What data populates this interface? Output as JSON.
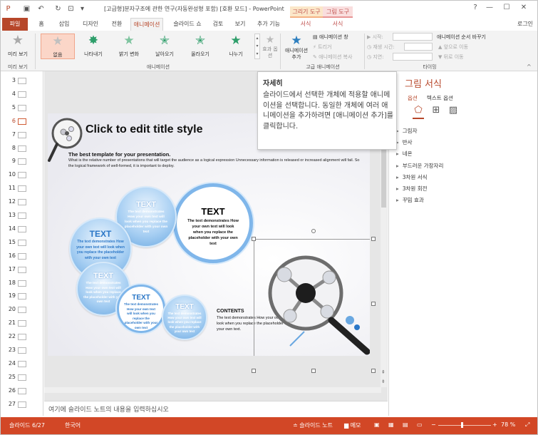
{
  "window": {
    "title": "[고급형]분자구조에 관한 연구(자동완성형 포함) [호환 모드] - PowerPoint",
    "contextual_tabs": [
      "그리기 도구",
      "그림 도구"
    ],
    "contextual_subtabs": [
      "서식",
      "서식"
    ],
    "controls": [
      "?",
      "—",
      "☐",
      "✕"
    ],
    "signin": "로그인"
  },
  "tabs": [
    "파일",
    "홈",
    "삽입",
    "디자인",
    "전환",
    "애니메이션",
    "슬라이드 쇼",
    "검토",
    "보기",
    "추가 기능"
  ],
  "ribbon": {
    "preview": {
      "label": "미리 보기",
      "group": "미리 보기"
    },
    "gallery": [
      {
        "label": "없음",
        "icon": "star-icon"
      },
      {
        "label": "나타내기",
        "icon": "star-burst-icon"
      },
      {
        "label": "밝기 변화",
        "icon": "star-icon"
      },
      {
        "label": "날아오기",
        "icon": "star-icon"
      },
      {
        "label": "올라오기",
        "icon": "star-icon"
      },
      {
        "label": "나누기",
        "icon": "star-icon"
      }
    ],
    "effect_options": {
      "label": "효과 옵션"
    },
    "animation_group": "애니메이션",
    "add_animation": {
      "label": "애니메이션 추가"
    },
    "advanced": {
      "pane": "애니메이션 창",
      "trigger": "트리거",
      "painter": "애니메이션 복사",
      "group": "고급 애니메이션"
    },
    "timing": {
      "start_label": "시작:",
      "duration_label": "재생 시간:",
      "delay_label": "지연:",
      "reorder": "애니메이션 순서 바꾸기",
      "earlier": "앞으로 이동",
      "later": "뒤로 이동",
      "group": "타이밍"
    }
  },
  "thumbnails": [
    {
      "n": "3"
    },
    {
      "n": "4"
    },
    {
      "n": "5"
    },
    {
      "n": "6",
      "selected": true
    },
    {
      "n": "7"
    },
    {
      "n": "8"
    },
    {
      "n": "9"
    },
    {
      "n": "10"
    },
    {
      "n": "11"
    },
    {
      "n": "12"
    },
    {
      "n": "13"
    },
    {
      "n": "14"
    },
    {
      "n": "15"
    },
    {
      "n": "16"
    },
    {
      "n": "17"
    },
    {
      "n": "18"
    },
    {
      "n": "19"
    },
    {
      "n": "20"
    },
    {
      "n": "21"
    },
    {
      "n": "22"
    },
    {
      "n": "23"
    },
    {
      "n": "24"
    },
    {
      "n": "25"
    },
    {
      "n": "26"
    },
    {
      "n": "27"
    }
  ],
  "slide": {
    "title": "Click to edit title style",
    "subtitle": "The best template for your presentation.",
    "description": "What is the relative number of presentations that will target the audience as a logical expression Unnecessary information is released or increased alignment will fail. So the logical framework of well-formed, it is important to deploy.",
    "circles": [
      {
        "heading": "TEXT",
        "text": "The text demonstrates How your own text will look when you replace the placeholder with your own text"
      },
      {
        "heading": "TEXT",
        "text": "The text demonstrates How your own text will look when you replace the placeholder with your own text"
      },
      {
        "heading": "TEXT",
        "text": "The text demonstrates How your own text will look when you replace the placeholder with your own text"
      },
      {
        "heading": "TEXT",
        "text": "The text demonstrates How your own text will look when you replace the placeholder with your own text"
      },
      {
        "heading": "TEXT",
        "text": "The text demonstrates How your own text will look when you replace the placeholder with your own text"
      },
      {
        "heading": "TEXT",
        "text": "The text demonstrates How your own text will look when you replace the placeholder with your own text"
      }
    ],
    "contents_heading": "CONTENTS",
    "contents_text": "The text demonstrates How your own text will look when you replace the placeholder with your own text."
  },
  "notes_placeholder": "여기에 슬라이드 노트의 내용을 입력하십시오",
  "tooltip": {
    "title": "자세히",
    "body": "슬라이드에서 선택한 개체에 적용할 애니메이션을 선택합니다. 동일한 개체에 여러 애니메이션을 추가하려면 [애니메이션 추가]를 클릭합니다."
  },
  "format_pane": {
    "title": "그림 서식",
    "tabs": [
      "옵션",
      "텍스트 옵션"
    ],
    "sections": [
      "그림자",
      "반사",
      "네온",
      "부드러운 가장자리",
      "3차원 서식",
      "3차원 회전",
      "꾸밈 효과"
    ]
  },
  "status": {
    "slide_counter": "슬라이드 6/27",
    "language": "한국어",
    "notes": "슬라이드 노트",
    "comments": "메모",
    "zoom": "78 %"
  }
}
